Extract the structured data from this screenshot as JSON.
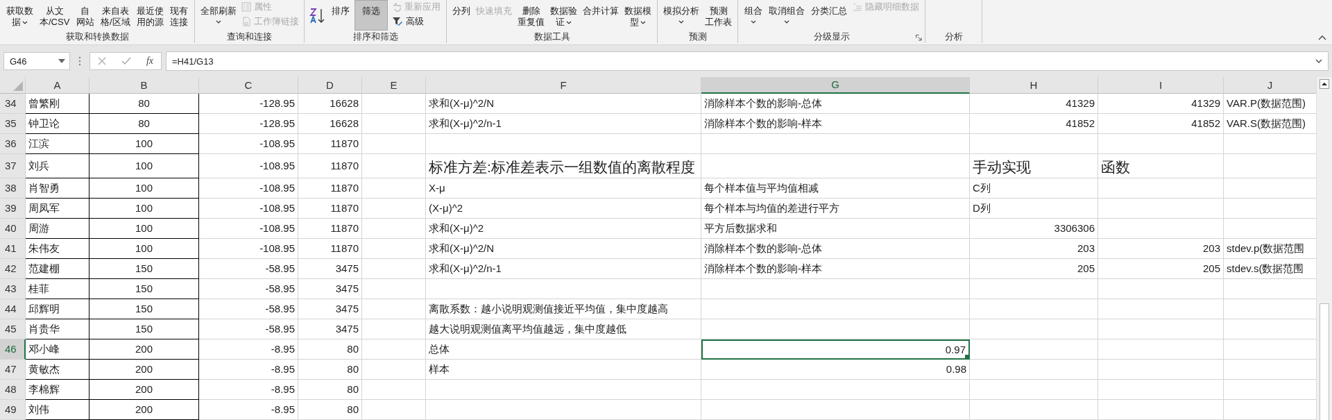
{
  "ribbon": {
    "groups": [
      {
        "label": "获取和转换数据",
        "launcher": false,
        "items": [
          {
            "kind": "large",
            "lines": [
              "获取数",
              "据"
            ],
            "dropdown": true,
            "disabled": false,
            "pressed": false
          },
          {
            "kind": "large",
            "lines": [
              "从文",
              "本/CSV"
            ],
            "dropdown": false,
            "disabled": false,
            "pressed": false
          },
          {
            "kind": "large",
            "lines": [
              "自",
              "网站"
            ],
            "dropdown": false,
            "disabled": false,
            "pressed": false
          },
          {
            "kind": "large",
            "lines": [
              "来自表",
              "格/区域"
            ],
            "dropdown": false,
            "disabled": false,
            "pressed": false
          },
          {
            "kind": "large",
            "lines": [
              "最近使",
              "用的源"
            ],
            "dropdown": false,
            "disabled": false,
            "pressed": false
          },
          {
            "kind": "large",
            "lines": [
              "现有",
              "连接"
            ],
            "dropdown": false,
            "disabled": false,
            "pressed": false
          }
        ]
      },
      {
        "label": "查询和连接",
        "launcher": false,
        "items": [
          {
            "kind": "large",
            "lines": [
              "全部刷新"
            ],
            "dropdown": true,
            "disabled": false,
            "pressed": false
          },
          {
            "kind": "stack",
            "items": [
              {
                "label": "属性",
                "disabled": true
              },
              {
                "label": "工作簿链接",
                "disabled": true
              }
            ]
          }
        ]
      },
      {
        "label": "排序和筛选",
        "launcher": false,
        "items": [
          {
            "kind": "sort_icon"
          },
          {
            "kind": "large",
            "lines": [
              "排序"
            ],
            "dropdown": false,
            "disabled": false,
            "pressed": false
          },
          {
            "kind": "large",
            "lines": [
              "筛选"
            ],
            "dropdown": false,
            "disabled": false,
            "pressed": true
          },
          {
            "kind": "stack",
            "items": [
              {
                "label": "重新应用",
                "disabled": true
              },
              {
                "label": "高级",
                "disabled": false
              }
            ]
          }
        ]
      },
      {
        "label": "数据工具",
        "launcher": false,
        "items": [
          {
            "kind": "large",
            "lines": [
              "分列"
            ],
            "dropdown": false,
            "disabled": false,
            "pressed": false
          },
          {
            "kind": "large",
            "lines": [
              "快速填充"
            ],
            "dropdown": false,
            "disabled": true,
            "pressed": false
          },
          {
            "kind": "large",
            "lines": [
              "删除",
              "重复值"
            ],
            "dropdown": false,
            "disabled": false,
            "pressed": false
          },
          {
            "kind": "large",
            "lines": [
              "数据验",
              "证"
            ],
            "dropdown": true,
            "disabled": false,
            "pressed": false
          },
          {
            "kind": "large",
            "lines": [
              "合并计算"
            ],
            "dropdown": false,
            "disabled": false,
            "pressed": false
          },
          {
            "kind": "large",
            "lines": [
              "数据模",
              "型"
            ],
            "dropdown": true,
            "disabled": false,
            "pressed": false
          }
        ]
      },
      {
        "label": "预测",
        "launcher": false,
        "items": [
          {
            "kind": "large",
            "lines": [
              "模拟分析"
            ],
            "dropdown": true,
            "disabled": false,
            "pressed": false
          },
          {
            "kind": "large",
            "lines": [
              "预测",
              "工作表"
            ],
            "dropdown": false,
            "disabled": false,
            "pressed": false
          }
        ]
      },
      {
        "label": "分级显示",
        "launcher": true,
        "items": [
          {
            "kind": "large",
            "lines": [
              "组合"
            ],
            "dropdown": true,
            "disabled": false,
            "pressed": false
          },
          {
            "kind": "large",
            "lines": [
              "取消组合"
            ],
            "dropdown": true,
            "disabled": false,
            "pressed": false
          },
          {
            "kind": "large",
            "lines": [
              "分类汇总"
            ],
            "dropdown": false,
            "disabled": false,
            "pressed": false
          },
          {
            "kind": "stack",
            "items": [
              {
                "label": "隐藏明细数据",
                "disabled": true
              }
            ]
          }
        ]
      },
      {
        "label": "分析",
        "launcher": false
      }
    ]
  },
  "formula_bar": {
    "name_box": "G46",
    "function_label": "fx",
    "formula": "=H41/G13"
  },
  "columns": [
    {
      "label": "A",
      "selected": false
    },
    {
      "label": "B",
      "selected": false
    },
    {
      "label": "C",
      "selected": false
    },
    {
      "label": "D",
      "selected": false
    },
    {
      "label": "E",
      "selected": false
    },
    {
      "label": "F",
      "selected": false
    },
    {
      "label": "G",
      "selected": true
    },
    {
      "label": "H",
      "selected": false
    },
    {
      "label": "I",
      "selected": false
    },
    {
      "label": "J",
      "selected": false
    }
  ],
  "rows": [
    {
      "label": "34",
      "selected": false,
      "kind": "normal",
      "cells": {
        "A": "曾繁刚",
        "B": {
          "value": "80"
        },
        "C": {
          "value": "-128.95"
        },
        "D": {
          "value": "16628"
        },
        "F": "求和(X-μ)^2/N",
        "G": "消除样本个数的影响-总体",
        "H": {
          "value": "41329"
        },
        "I": {
          "value": "41329"
        },
        "J": "VAR.P(数据范围)"
      }
    },
    {
      "label": "35",
      "selected": false,
      "kind": "normal",
      "cells": {
        "A": "钟卫论",
        "B": {
          "value": "80"
        },
        "C": {
          "value": "-128.95"
        },
        "D": {
          "value": "16628"
        },
        "F": "求和(X-μ)^2/n-1",
        "G": "消除样本个数的影响-样本",
        "H": {
          "value": "41852"
        },
        "I": {
          "value": "41852"
        },
        "J": "VAR.S(数据范围)"
      }
    },
    {
      "label": "36",
      "selected": false,
      "kind": "normal",
      "cells": {
        "A": "江滨",
        "B": {
          "value": "100"
        },
        "C": {
          "value": "-108.95"
        },
        "D": {
          "value": "11870"
        }
      }
    },
    {
      "label": "37",
      "selected": false,
      "kind": "heading",
      "cells": {
        "A": "刘兵",
        "B": {
          "value": "100"
        },
        "C": {
          "value": "-108.95"
        },
        "D": {
          "value": "11870"
        },
        "F": "标准方差:标准差表示一组数值的离散程度",
        "H": "手动实现",
        "I": "函数"
      }
    },
    {
      "label": "38",
      "selected": false,
      "kind": "normal",
      "cells": {
        "A": "肖智勇",
        "B": {
          "value": "100"
        },
        "C": {
          "value": "-108.95"
        },
        "D": {
          "value": "11870"
        },
        "F": "X-μ",
        "G": "每个样本值与平均值相减",
        "H": "C列"
      }
    },
    {
      "label": "39",
      "selected": false,
      "kind": "normal",
      "cells": {
        "A": "周凤军",
        "B": {
          "value": "100"
        },
        "C": {
          "value": "-108.95"
        },
        "D": {
          "value": "11870"
        },
        "F": "(X-μ)^2",
        "G": "每个样本与均值的差进行平方",
        "H": "D列"
      }
    },
    {
      "label": "40",
      "selected": false,
      "kind": "normal",
      "cells": {
        "A": "周游",
        "B": {
          "value": "100"
        },
        "C": {
          "value": "-108.95"
        },
        "D": {
          "value": "11870"
        },
        "F": "求和(X-μ)^2",
        "G": "平方后数据求和",
        "H": {
          "value": "3306306"
        }
      }
    },
    {
      "label": "41",
      "selected": false,
      "kind": "normal",
      "cells": {
        "A": "朱伟友",
        "B": {
          "value": "100"
        },
        "C": {
          "value": "-108.95"
        },
        "D": {
          "value": "11870"
        },
        "F": "求和(X-μ)^2/N",
        "G": "消除样本个数的影响-总体",
        "H": {
          "value": "203"
        },
        "I": {
          "value": "203"
        },
        "J": "stdev.p(数据范围"
      }
    },
    {
      "label": "42",
      "selected": false,
      "kind": "normal",
      "cells": {
        "A": "范建棚",
        "B": {
          "value": "150"
        },
        "C": {
          "value": "-58.95"
        },
        "D": {
          "value": "3475"
        },
        "F": "求和(X-μ)^2/n-1",
        "G": "消除样本个数的影响-样本",
        "H": {
          "value": "205"
        },
        "I": {
          "value": "205"
        },
        "J": "stdev.s(数据范围"
      }
    },
    {
      "label": "43",
      "selected": false,
      "kind": "normal",
      "cells": {
        "A": "桂菲",
        "B": {
          "value": "150"
        },
        "C": {
          "value": "-58.95"
        },
        "D": {
          "value": "3475"
        }
      }
    },
    {
      "label": "44",
      "selected": false,
      "kind": "normal",
      "cells": {
        "A": "邱辉明",
        "B": {
          "value": "150"
        },
        "C": {
          "value": "-58.95"
        },
        "D": {
          "value": "3475"
        },
        "F": "离散系数：越小说明观测值接近平均值，集中度越高"
      }
    },
    {
      "label": "45",
      "selected": false,
      "kind": "normal",
      "cells": {
        "A": "肖贵华",
        "B": {
          "value": "150"
        },
        "C": {
          "value": "-58.95"
        },
        "D": {
          "value": "3475"
        },
        "F": "越大说明观测值离平均值越远，集中度越低"
      }
    },
    {
      "label": "46",
      "selected": true,
      "kind": "normal",
      "cells": {
        "A": "邓小峰",
        "B": {
          "value": "200"
        },
        "C": {
          "value": "-8.95"
        },
        "D": {
          "value": "80"
        },
        "F": "总体",
        "G": {
          "value": "0.97"
        }
      }
    },
    {
      "label": "47",
      "selected": false,
      "kind": "normal",
      "cells": {
        "A": "黄敏杰",
        "B": {
          "value": "200"
        },
        "C": {
          "value": "-8.95"
        },
        "D": {
          "value": "80"
        },
        "F": "样本",
        "G": {
          "value": "0.98"
        }
      }
    },
    {
      "label": "48",
      "selected": false,
      "kind": "normal",
      "cells": {
        "A": "李棉辉",
        "B": {
          "value": "200"
        },
        "C": {
          "value": "-8.95"
        },
        "D": {
          "value": "80"
        }
      }
    },
    {
      "label": "49",
      "selected": false,
      "kind": "normal",
      "cells": {
        "A": "刘伟",
        "B": {
          "value": "200"
        },
        "C": {
          "value": "-8.95"
        },
        "D": {
          "value": "80"
        }
      }
    }
  ]
}
